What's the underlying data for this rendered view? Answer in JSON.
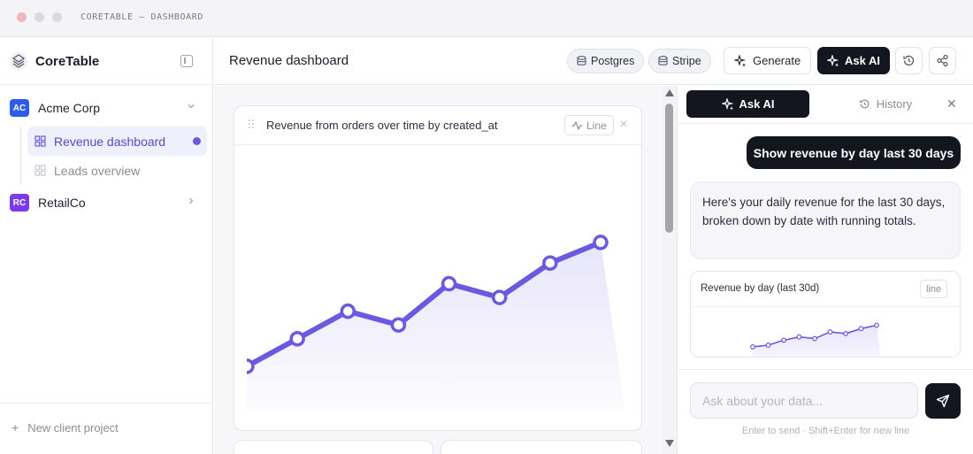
{
  "window": {
    "title": "CORETABLE — DASHBOARD"
  },
  "colors": {
    "accent": "#6a5ae0",
    "dark": "#14161f",
    "acme_badge": "#2f5bea",
    "retail_badge": "#7c3aed",
    "dot_red": "#f0b7bb",
    "dot_gray": "#d9dade"
  },
  "sidebar": {
    "brand": "CoreTable",
    "clients": [
      {
        "initials": "AC",
        "name": "Acme Corp",
        "expanded": true
      },
      {
        "initials": "RC",
        "name": "RetailCo",
        "expanded": false
      }
    ],
    "dashboards": [
      {
        "label": "Revenue dashboard",
        "active": true
      },
      {
        "label": "Leads overview",
        "active": false
      }
    ],
    "new_project": "New client project"
  },
  "header": {
    "title": "Revenue dashboard",
    "sources": [
      "Postgres",
      "Stripe"
    ],
    "generate_label": "Generate",
    "ask_label": "Ask AI"
  },
  "card": {
    "title": "Revenue from orders over time by created_at",
    "type_label": "Line"
  },
  "chart_data": [
    {
      "type": "line",
      "title": "Revenue from orders over time by created_at",
      "series": [
        {
          "values": [
            2,
            6,
            10,
            8,
            14,
            12,
            17,
            20
          ]
        }
      ],
      "ylim": [
        -2,
        34
      ],
      "grid": false
    },
    {
      "type": "line",
      "title": "Revenue by day (last 30d)",
      "series": [
        {
          "values": [
            1,
            2,
            5,
            7,
            6,
            10,
            9,
            12,
            14
          ]
        }
      ],
      "ylim": [
        -6,
        25
      ],
      "grid": false
    }
  ],
  "panel": {
    "tab_ask": "Ask AI",
    "tab_history": "History",
    "user_message": "Show revenue by day last 30 days",
    "ai_message": "Here's your daily revenue for the last 30 days, broken down by date with running totals.",
    "mini_title": "Revenue by day (last 30d)",
    "mini_type": "line",
    "input_placeholder": "Ask about your data...",
    "hint": "Enter to send · Shift+Enter for new line"
  }
}
